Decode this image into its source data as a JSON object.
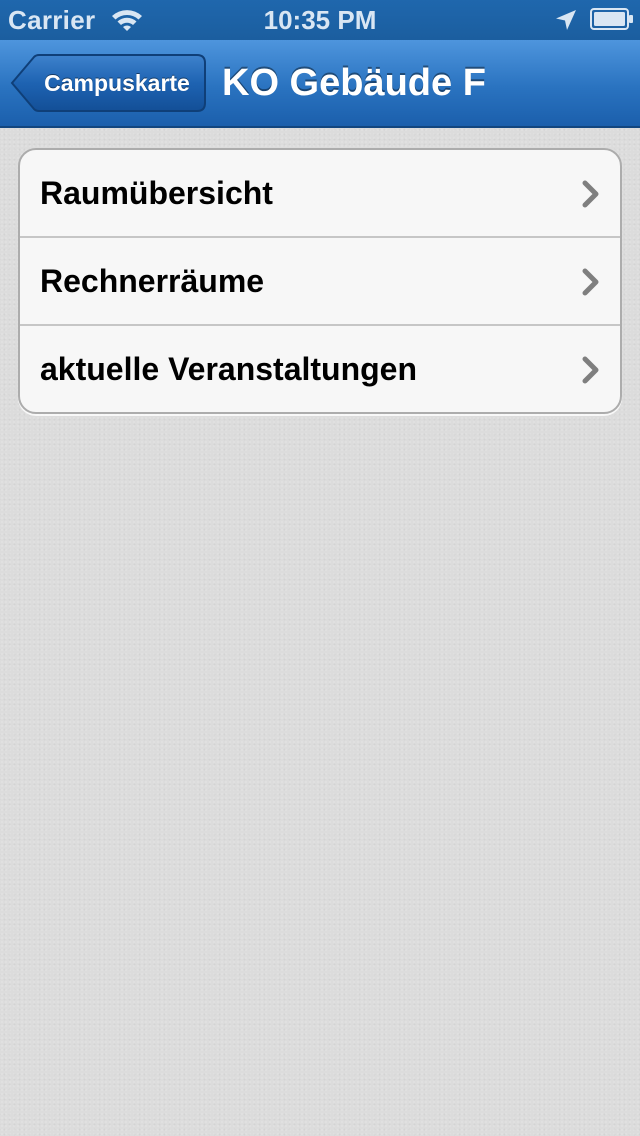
{
  "status_bar": {
    "carrier": "Carrier",
    "time": "10:35 PM",
    "icons": [
      "wifi-icon",
      "location-arrow-icon",
      "battery-icon"
    ]
  },
  "nav_bar": {
    "back_label": "Campuskarte",
    "title": "KO Gebäude F"
  },
  "menu": {
    "items": [
      {
        "label": "Raumübersicht",
        "icon": "chevron-right-icon"
      },
      {
        "label": "Rechnerräume",
        "icon": "chevron-right-icon"
      },
      {
        "label": "aktuelle Veranstaltungen",
        "icon": "chevron-right-icon"
      }
    ]
  },
  "colors": {
    "nav_bar_top": "#4e95dd",
    "nav_bar_bottom": "#1b5fac",
    "status_bar": "#1f67ad",
    "background": "#dcdcdc",
    "cell_background": "#f7f7f7",
    "chevron": "#7f7f7f"
  }
}
